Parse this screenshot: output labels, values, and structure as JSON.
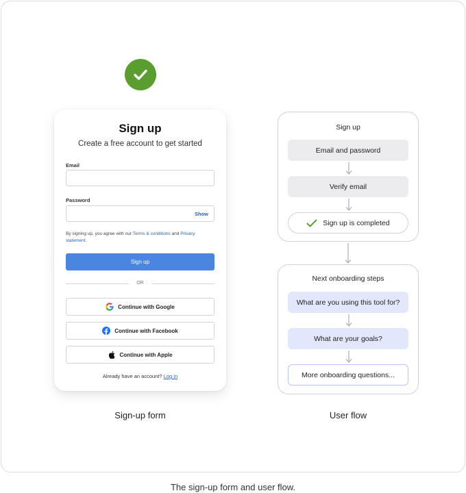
{
  "signup_card": {
    "title": "Sign up",
    "subtitle": "Create a free account to get started",
    "email_label": "Email",
    "email_value": "",
    "password_label": "Password",
    "password_value": "",
    "show_label": "Show",
    "legal_prefix": "By signing up, you agree with our ",
    "terms_link": "Terms & conditions",
    "legal_and": " and ",
    "privacy_link": "Privacy statement",
    "legal_suffix": ".",
    "signup_button": "Sign up",
    "or_text": "OR",
    "google_button": "Continue with Google",
    "facebook_button": "Continue with Facebook",
    "apple_button": "Continue with Apple",
    "login_prompt": "Already have an account? ",
    "login_link": "Log in"
  },
  "signup_caption": "Sign-up form",
  "flow": {
    "caption": "User flow",
    "signup_panel": {
      "title": "Sign up",
      "steps": [
        "Email and password",
        "Verify email",
        "Sign up is completed"
      ]
    },
    "onboarding_panel": {
      "title": "Next onboarding steps",
      "steps": [
        "What are you using this tool for?",
        "What are your goals?",
        "More onboarding questions..."
      ]
    }
  },
  "figure_caption": "The sign-up form and user flow.",
  "colors": {
    "success_green": "#5a9e30",
    "primary_blue": "#4a86e0",
    "link_blue": "#2a5fb4",
    "step_gray": "#ececee",
    "step_blue": "#e2e7fb"
  },
  "icons": [
    "check-badge-icon",
    "google-icon",
    "facebook-icon",
    "apple-icon",
    "check-icon",
    "arrow-down-icon"
  ]
}
